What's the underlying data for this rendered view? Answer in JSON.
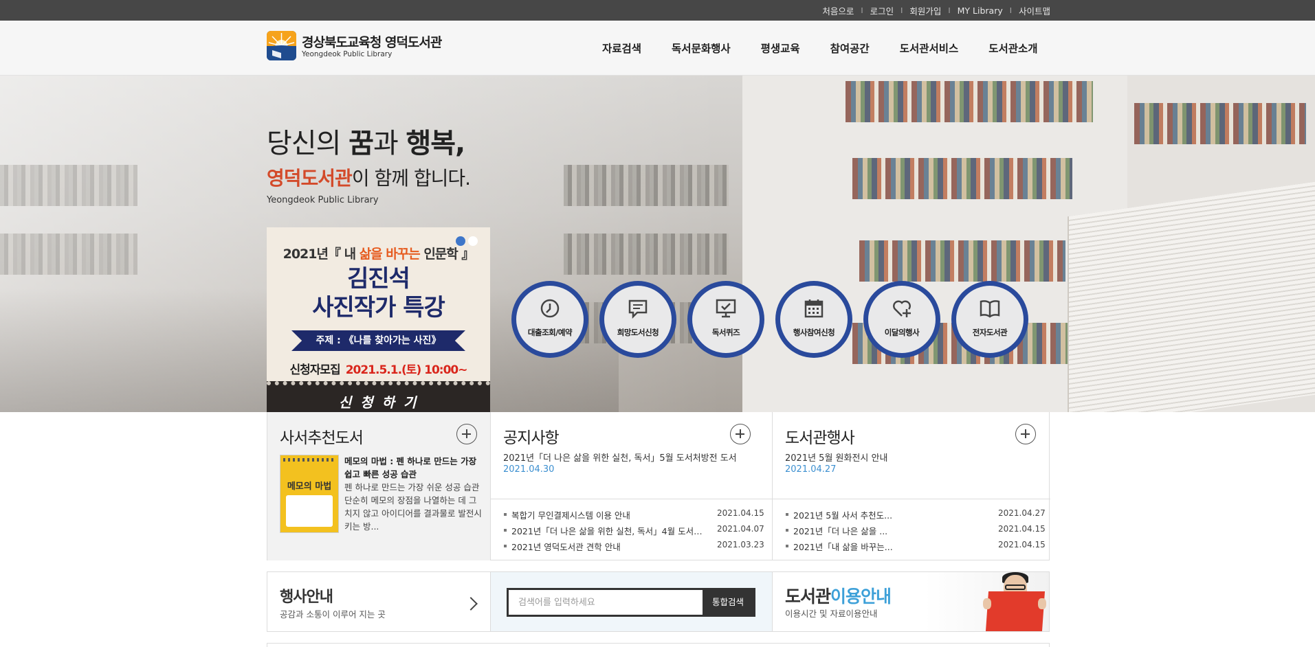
{
  "top_links": [
    "처음으로",
    "로그인",
    "회원가입",
    "MY Library",
    "사이트맵"
  ],
  "logo": {
    "name_ko": "경상북도교육청 영덕도서관",
    "name_en": "Yeongdeok Public Library"
  },
  "gnb": [
    "자료검색",
    "독서문화행사",
    "평생교육",
    "참여공간",
    "도서관서비스",
    "도서관소개"
  ],
  "hero": {
    "line1_pre": "당신의 ",
    "line1_b1": "꿈",
    "line1_mid": "과 ",
    "line1_b2": "행복,",
    "line2_accent": "영덕도서관",
    "line2_rest": "이 함께 합니다.",
    "line3": "Yeongdeok Public Library"
  },
  "banner": {
    "line1_a": "2021년『 내 ",
    "line1_b": "삶을 바꾸는",
    "line1_c": " 인문학 』",
    "headline1": "김진석",
    "headline2": "사진작가 특강",
    "topic": "주제 : 《나를 찾아가는 사진》",
    "recruit": "신청자모집",
    "datetime": "2021.5.1.(토) 10:00~",
    "apply": "신 청 하 기"
  },
  "quick_menu": [
    {
      "label": "대출조회/예약",
      "icon": "clock-icon"
    },
    {
      "label": "희망도서신청",
      "icon": "chat-icon"
    },
    {
      "label": "독서퀴즈",
      "icon": "monitor-check-icon"
    },
    {
      "label": "행사참여신청",
      "icon": "calendar-icon"
    },
    {
      "label": "이달의행사",
      "icon": "heart-plus-icon"
    },
    {
      "label": "전자도서관",
      "icon": "open-book-icon"
    }
  ],
  "recommend": {
    "title": "사서추천도서",
    "cover_text": "메모의 마법",
    "book_title": "메모의 마법 : 펜 하나로 만드는 가장 쉽고 빠른 성공 습관",
    "book_desc": "펜 하나로 만드는 가장 쉬운 성공 습관단순히 메모의 장점을 나열하는 데 그치지 않고 아이디어를 결과물로 발전시키는 방..."
  },
  "notice": {
    "title": "공지사항",
    "featured_title": "2021년「더 나은 삶을 위한 실천, 독서」5월 도서처방전 도서",
    "featured_date": "2021.04.30",
    "items": [
      {
        "title": "복합기 무인결제시스템 이용 안내",
        "date": "2021.04.15"
      },
      {
        "title": "2021년「더 나은 삶을 위한 실천, 독서」4월 도서…",
        "date": "2021.04.07"
      },
      {
        "title": "2021년 영덕도서관 견학 안내",
        "date": "2021.03.23"
      }
    ]
  },
  "events": {
    "title": "도서관행사",
    "featured_title": "2021년 5월 원화전시 안내",
    "featured_date": "2021.04.27",
    "items": [
      {
        "title": "2021년 5월 사서 추천도...",
        "date": "2021.04.27"
      },
      {
        "title": "2021년「더 나은 삶을 ...",
        "date": "2021.04.15"
      },
      {
        "title": "2021년「내 삶을 바꾸는...",
        "date": "2021.04.15"
      }
    ]
  },
  "event_guide": {
    "title": "행사안내",
    "subtitle": "공감과 소통이 이루어 지는 곳"
  },
  "search": {
    "placeholder": "검색어를 입력하세요",
    "button": "통합검색"
  },
  "usage": {
    "title_a": "도서관",
    "title_b": "이용안내",
    "subtitle": "이용시간 및 자료이용안내"
  },
  "colors": {
    "accent_red": "#d34a2a",
    "circle_blue": "#2a4a9c",
    "date_blue": "#3b8fd0",
    "topbar": "#474747"
  }
}
